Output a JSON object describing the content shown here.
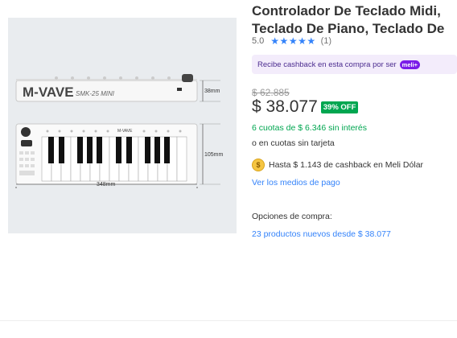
{
  "product": {
    "image": {
      "brand": "M-VAVE",
      "model": "SMK-25 MINI",
      "dim_height": "38mm",
      "dim_depth": "105mm",
      "dim_width": "348mm"
    },
    "title": "Controlador De Teclado Midi, Teclado De Piano, Teclado De",
    "rating": "5.0",
    "stars": "★★★★★",
    "reviews": "(1)"
  },
  "cashback_banner": {
    "text": "Recibe cashback en esta compra por ser",
    "badge": "meli+"
  },
  "pricing": {
    "old_price": "$ 62.885",
    "price": "$ 38.077",
    "discount": "39% OFF",
    "installments": "6 cuotas de $ 6.346 sin interés",
    "installments_alt": "o en cuotas sin tarjeta"
  },
  "cashback": {
    "text": "Hasta $ 1.143 de cashback en Meli Dólar",
    "icon": "coin-icon"
  },
  "payment_methods_link": "Ver los medios de pago",
  "purchase_options": {
    "label": "Opciones de compra:",
    "new_products_link": "23 productos nuevos desde $ 38.077"
  },
  "colors": {
    "accent": "#3483fa",
    "green": "#00a650",
    "meli_purple": "#7a1ce8"
  }
}
